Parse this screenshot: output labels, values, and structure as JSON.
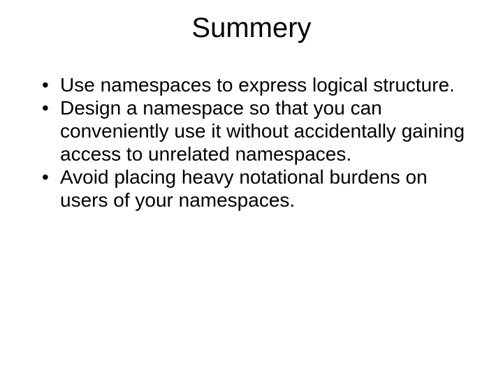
{
  "slide": {
    "title": "Summery",
    "bullets": [
      "Use namespaces to express logical structure.",
      "Design a namespace so that you can conveniently use it without accidentally gaining access to unrelated namespaces.",
      "Avoid placing heavy notational burdens on users of your namespaces."
    ]
  }
}
